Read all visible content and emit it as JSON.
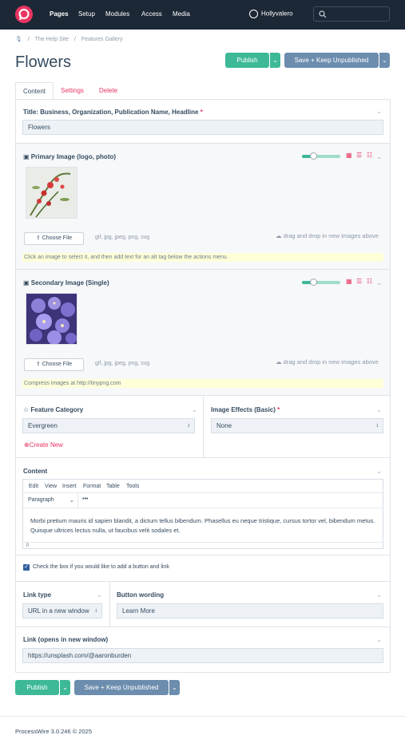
{
  "topbar": {
    "nav": [
      "Pages",
      "Setup",
      "Modules",
      "Access",
      "Media"
    ],
    "user": "Hollyvalero"
  },
  "breadcrumb": [
    "The Help Site",
    "Features Gallery"
  ],
  "page": {
    "title": "Flowers"
  },
  "actions": {
    "publish": "Publish",
    "save_keep": "Save + Keep Unpublished"
  },
  "tabs": [
    "Content",
    "Settings",
    "Delete"
  ],
  "fields": {
    "title": {
      "label": "Title: Business, Organization, Publication Name, Headline",
      "value": "Flowers"
    },
    "primary_image": {
      "label": "Primary Image (logo, photo)",
      "choose": "Choose File",
      "types": "gif, jpg, jpeg, png, svg",
      "dnd": "drag and drop in new images above",
      "note": "Click an image to select it, and then add text for an alt tag below the actions menu."
    },
    "secondary_image": {
      "label": "Secondary Image (Single)",
      "choose": "Choose File",
      "types": "gif, jpg, jpeg, png, svg",
      "dnd": "drag and drop in new images above",
      "note": "Compress images at http://tinypng.com"
    },
    "feature_category": {
      "label": "Feature Category",
      "value": "Evergreen",
      "create": "Create New"
    },
    "image_effects": {
      "label": "Image Effects (Basic)",
      "value": "None"
    },
    "content": {
      "label": "Content",
      "menu": [
        "Edit",
        "View",
        "Insert",
        "Format",
        "Table",
        "Tools"
      ],
      "format": "Paragraph",
      "more": "•••",
      "text": "Morbi pretium mauris id sapien blandit, a dictum tellus bibendum. Phasellus eu neque tristique, cursus tortor vel, bibendum metus. Quisque ultrices lectus nulla, ut faucibus velit sodales et.",
      "path": "p"
    },
    "add_button": {
      "label": "Check the box if you would like to add a button and link",
      "checked": true
    },
    "link_type": {
      "label": "Link type",
      "value": "URL in a new window"
    },
    "button_wording": {
      "label": "Button wording",
      "value": "Learn More"
    },
    "link": {
      "label": "Link (opens in new window)",
      "value": "https://unsplash.com/@aaronburden"
    }
  },
  "footer": "ProcessWire 3.0.246 © 2025",
  "colors": {
    "brand": "#e83561",
    "publish": "#3eb998",
    "save": "#6c8dae",
    "topbar": "#1c2836"
  }
}
